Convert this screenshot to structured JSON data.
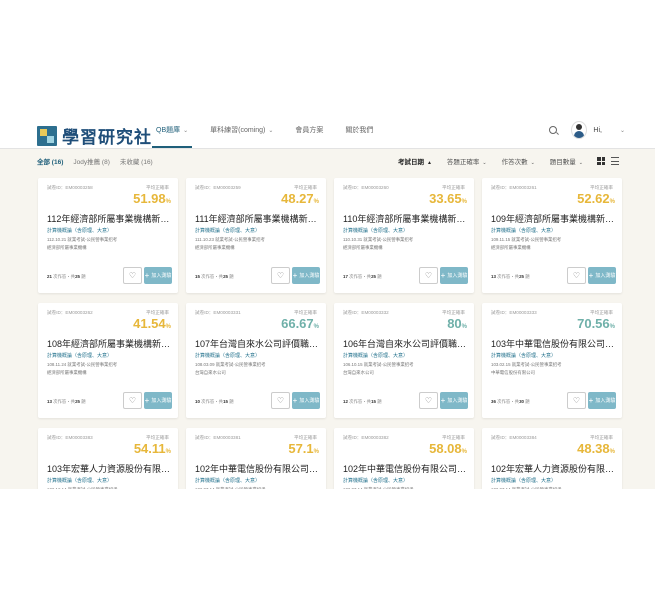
{
  "header": {
    "logo_text": "學習研究社",
    "nav": [
      {
        "label": "QB題庫",
        "active": true,
        "has_caret": true
      },
      {
        "label": "單科練習(coming)",
        "active": false,
        "has_caret": true
      },
      {
        "label": "會員方案",
        "active": false,
        "has_caret": false
      },
      {
        "label": "關於我們",
        "active": false,
        "has_caret": false
      }
    ],
    "greeting": "Hi,"
  },
  "toolbar": {
    "filters": [
      "全部 (16)",
      "Jody推薦 (8)",
      "未收藏 (16)"
    ],
    "sorts": [
      {
        "label": "考試日期",
        "arrow": "▲",
        "active": true
      },
      {
        "label": "答題正確率",
        "arrow": "⌄",
        "active": false
      },
      {
        "label": "作答次數",
        "arrow": "⌄",
        "active": false
      },
      {
        "label": "題目數量",
        "arrow": "⌄",
        "active": false
      }
    ]
  },
  "colors": {
    "gold": "#e7b73a",
    "teal": "#6fb0a9",
    "add_button": "#7fb8c8"
  },
  "labels": {
    "accuracy": "平均正確率",
    "add": "加入測驗"
  },
  "cards": [
    {
      "code": "試卷ID：EM00003258",
      "accuracy": "51.98",
      "color": "#e7b73a",
      "title": "112年經濟部所屬事業機構新…",
      "subject": "計算機概論（含原理、大意）",
      "meta1": "112.10.21 就業考試-公民營事業招考",
      "meta2": "經濟部所屬事業機構",
      "answers": "21",
      "questions": "25"
    },
    {
      "code": "試卷ID：EM00003259",
      "accuracy": "48.27",
      "color": "#e7b73a",
      "title": "111年經濟部所屬事業機構新…",
      "subject": "計算機概論（含原理、大意）",
      "meta1": "111.10.23 就業考試-公民營事業招考",
      "meta2": "經濟部所屬事業機構",
      "answers": "15",
      "questions": "25"
    },
    {
      "code": "試卷ID：EM00003260",
      "accuracy": "33.65",
      "color": "#e7b73a",
      "title": "110年經濟部所屬事業機構新…",
      "subject": "計算機概論（含原理、大意）",
      "meta1": "110.10.31 就業考試-公民營事業招考",
      "meta2": "經濟部所屬事業機構",
      "answers": "17",
      "questions": "25"
    },
    {
      "code": "試卷ID：EM00003261",
      "accuracy": "52.62",
      "color": "#e7b73a",
      "title": "109年經濟部所屬事業機構新…",
      "subject": "計算機概論（含原理、大意）",
      "meta1": "109.11.15 就業考試-公民營事業招考",
      "meta2": "經濟部所屬事業機構",
      "answers": "13",
      "questions": "25"
    },
    {
      "code": "試卷ID：EM00003262",
      "accuracy": "41.54",
      "color": "#e7b73a",
      "title": "108年經濟部所屬事業機構新…",
      "subject": "計算機概論（含原理、大意）",
      "meta1": "108.11.24 就業考試-公民營事業招考",
      "meta2": "經濟部所屬事業機構",
      "answers": "13",
      "questions": "25"
    },
    {
      "code": "試卷ID：EM00003331",
      "accuracy": "66.67",
      "color": "#6fb0a9",
      "title": "107年台灣自來水公司評價職…",
      "subject": "計算機概論（含原理、大意）",
      "meta1": "108.03.09 就業考試-公民營事業招考",
      "meta2": "台灣自來水公司",
      "answers": "10",
      "questions": "15"
    },
    {
      "code": "試卷ID：EM00003332",
      "accuracy": "80",
      "color": "#6fb0a9",
      "title": "106年台灣自來水公司評價職…",
      "subject": "計算機概論（含原理、大意）",
      "meta1": "106.10.15 就業考試-公民營事業招考",
      "meta2": "台灣自來水公司",
      "answers": "12",
      "questions": "15"
    },
    {
      "code": "試卷ID：EM00003333",
      "accuracy": "70.56",
      "color": "#6fb0a9",
      "title": "103年中華電信股份有限公司…",
      "subject": "計算機概論（含原理、大意）",
      "meta1": "103.02.15 就業考試-公民營事業招考",
      "meta2": "中華電信股份有限公司",
      "answers": "36",
      "questions": "30"
    },
    {
      "code": "試卷ID：EM00003383",
      "accuracy": "54.11",
      "color": "#e7b73a",
      "title": "103年宏華人力資源股份有限…",
      "subject": "計算機概論（含原理、大意）",
      "meta1": "102.12.14 就業考試-公民營事業招考",
      "meta2": "",
      "answers": "",
      "questions": ""
    },
    {
      "code": "試卷ID：EM00003381",
      "accuracy": "57.1",
      "color": "#e7b73a",
      "title": "102年中華電信股份有限公司…",
      "subject": "計算機概論（含原理、大意）",
      "meta1": "102.07.14 就業考試-公民營事業招考",
      "meta2": "",
      "answers": "",
      "questions": ""
    },
    {
      "code": "試卷ID：EM00003382",
      "accuracy": "58.08",
      "color": "#e7b73a",
      "title": "102年中華電信股份有限公司…",
      "subject": "計算機概論（含原理、大意）",
      "meta1": "102.07.14 就業考試-公民營事業招考",
      "meta2": "",
      "answers": "",
      "questions": ""
    },
    {
      "code": "試卷ID：EM00003384",
      "accuracy": "48.38",
      "color": "#e7b73a",
      "title": "102年宏華人力資源股份有限…",
      "subject": "計算機概論（含原理、大意）",
      "meta1": "102.07.14 就業考試-公民營事業招考",
      "meta2": "",
      "answers": "",
      "questions": ""
    }
  ]
}
